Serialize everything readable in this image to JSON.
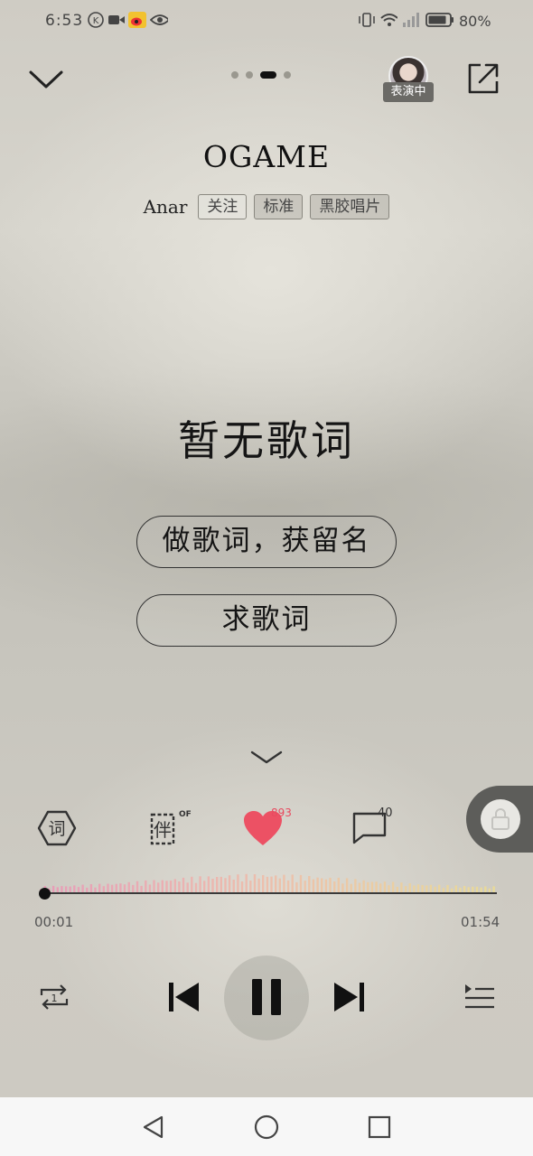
{
  "status_bar": {
    "time": "6:53",
    "battery": "80%",
    "left_icons": [
      "k-badge-icon",
      "video-icon",
      "weibo-icon",
      "eye-icon"
    ],
    "right_icons": [
      "vibrate-icon",
      "wifi-icon",
      "signal-icon",
      "battery-icon"
    ]
  },
  "header": {
    "pages": 4,
    "active_page": 2,
    "live_badge": "表演中"
  },
  "song": {
    "title": "OGAME",
    "artist": "Anar",
    "follow_label": "关注",
    "quality_label": "标准",
    "style_label": "黑胶唱片"
  },
  "lyrics": {
    "empty_text": "暂无歌词",
    "make_lyrics_button": "做歌词，获留名",
    "request_lyrics_button": "求歌词"
  },
  "actions": {
    "lyrics_icon_text": "词",
    "accompany_icon_text": "伴",
    "accompany_state": "OFF",
    "like_count": "893",
    "comment_count": "40"
  },
  "player": {
    "current_time": "00:01",
    "total_time": "01:54",
    "progress": 0.009,
    "is_playing": true,
    "repeat_mode_badge": "1"
  },
  "colors": {
    "like": "#e84a5f",
    "wave_start": "#f08cb4",
    "wave_end": "#f2e08a"
  }
}
